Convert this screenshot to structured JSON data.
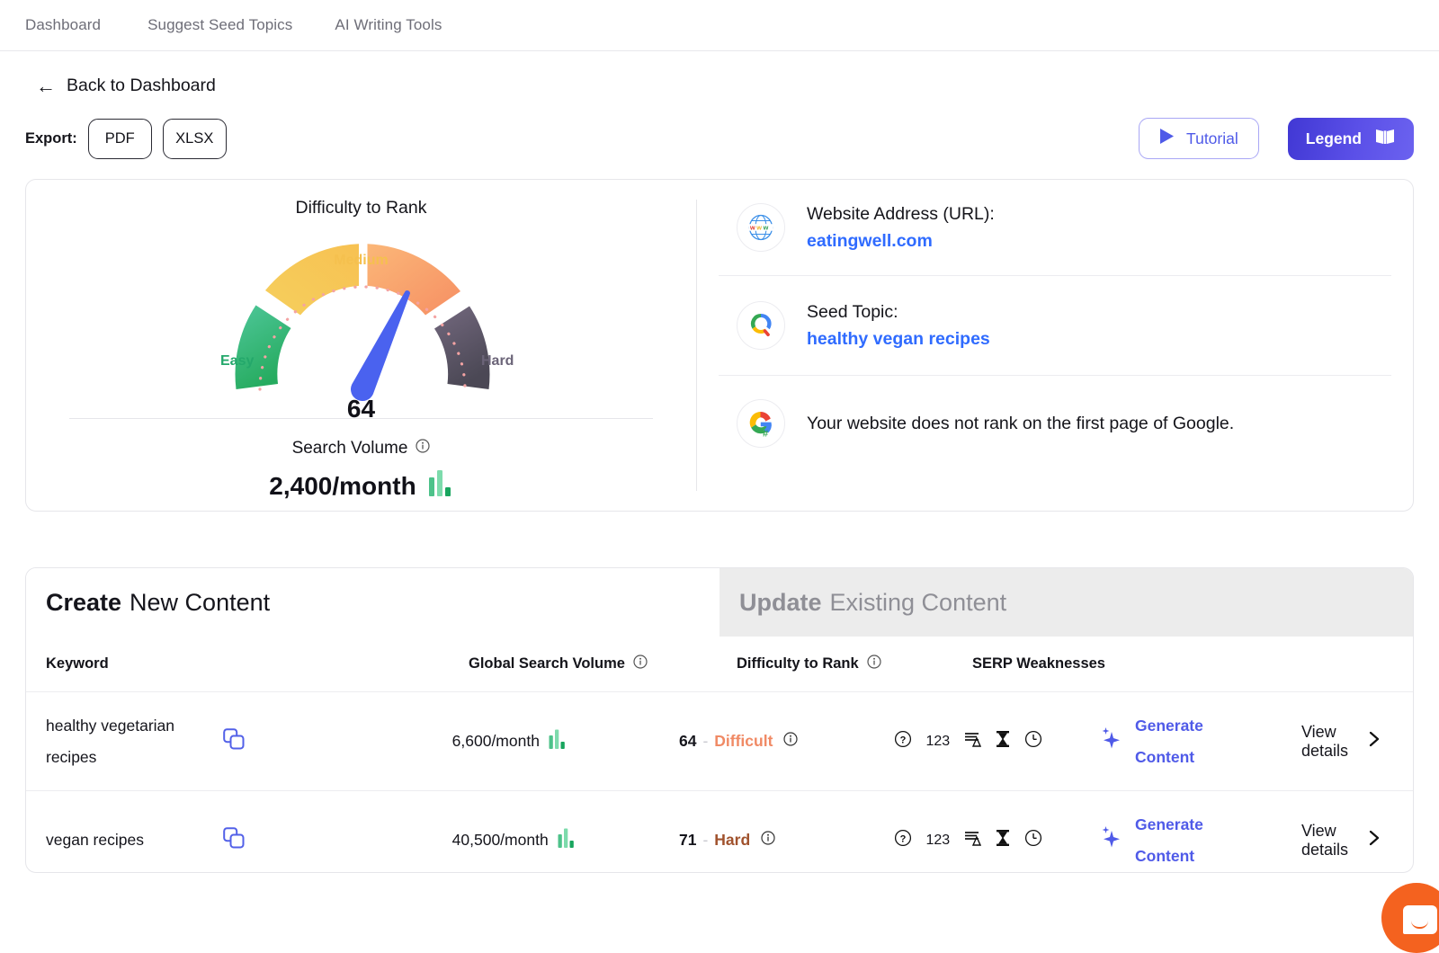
{
  "nav": {
    "items": [
      {
        "label": "Dashboard"
      },
      {
        "label": "Suggest Seed Topics"
      },
      {
        "label": "AI Writing Tools"
      }
    ]
  },
  "back": {
    "label": "Back to Dashboard",
    "arrow": "←"
  },
  "toolbar": {
    "export_label": "Export:",
    "pdf_label": "PDF",
    "xlsx_label": "XLSX",
    "tutorial_label": "Tutorial",
    "legend_label": "Legend"
  },
  "summary": {
    "gauge": {
      "title": "Difficulty to Rank",
      "value": "64",
      "label_easy": "Easy",
      "label_medium": "Medium",
      "label_hard": "Hard"
    },
    "search_volume": {
      "title": "Search Volume",
      "value": "2,400/month"
    },
    "info": [
      {
        "icon": "www-globe-icon",
        "label": "Website Address (URL):",
        "value": "eatingwell.com",
        "is_link": true
      },
      {
        "icon": "seed-topic-search-icon",
        "label": "Seed Topic:",
        "value": "healthy vegan recipes",
        "is_link": true
      },
      {
        "icon": "google-rank-icon",
        "label": "",
        "value": "Your website does not rank on the first page of Google.",
        "is_link": false
      }
    ]
  },
  "content": {
    "tabs": [
      {
        "bold": "Create",
        "rest": "New Content",
        "active": true
      },
      {
        "bold": "Update",
        "rest": "Existing Content",
        "active": false
      }
    ],
    "columns": [
      {
        "label": "Keyword",
        "info": false
      },
      {
        "label": "Global Search Volume",
        "info": true
      },
      {
        "label": "Difficulty to Rank",
        "info": true
      },
      {
        "label": "SERP Weaknesses",
        "info": false
      }
    ],
    "rows": [
      {
        "keyword": "healthy vegetarian recipes",
        "volume": "6,600/month",
        "difficulty_value": "64",
        "difficulty_dash": "-",
        "difficulty_label": "Difficult",
        "difficulty_color": "#f08a65",
        "serp_count": "123",
        "generate_label_1": "Generate",
        "generate_label_2": "Content",
        "view_details": "View details"
      },
      {
        "keyword": "vegan recipes",
        "volume": "40,500/month",
        "difficulty_value": "71",
        "difficulty_dash": "-",
        "difficulty_label": "Hard",
        "difficulty_color": "#a0522d",
        "serp_count": "123",
        "generate_label_1": "Generate",
        "generate_label_2": "Content",
        "view_details": "View details"
      }
    ]
  },
  "chart_data": {
    "type": "gauge",
    "title": "Difficulty to Rank",
    "value": 64,
    "range": [
      0,
      100
    ],
    "segments": [
      {
        "name": "Easy",
        "from": 0,
        "to": 25,
        "color": "#3fbf7f"
      },
      {
        "name": "Medium",
        "from": 25,
        "to": 50,
        "color": "#f5c04e"
      },
      {
        "name": "Medium",
        "from": 50,
        "to": 75,
        "color": "#f79a6e"
      },
      {
        "name": "Hard",
        "from": 75,
        "to": 100,
        "color": "#5e5a68"
      }
    ],
    "needle_value": 64,
    "ylabel": "",
    "xlabel": ""
  },
  "colors": {
    "accent": "#4f5ae8",
    "link": "#2f6bff",
    "easy": "#24a86b",
    "medium": "#f5c04e",
    "hard": "#6b6478",
    "chat": "#f4621f"
  }
}
